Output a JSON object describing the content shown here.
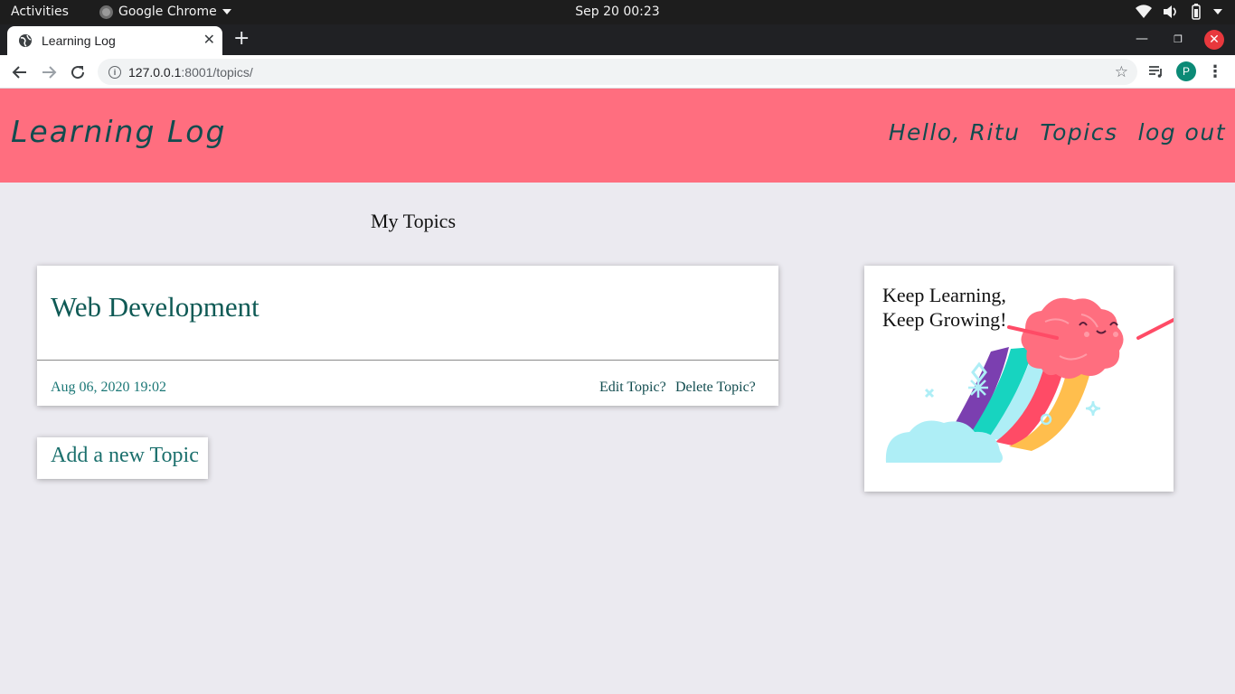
{
  "system_bar": {
    "activities": "Activities",
    "app_name": "Google Chrome",
    "clock": "Sep 20  00:23"
  },
  "browser": {
    "tab_title": "Learning Log",
    "url_host": "127.0.0.1",
    "url_rest": ":8001/topics/",
    "profile_initial": "P"
  },
  "site": {
    "brand": "Learning Log",
    "nav": {
      "greeting": "Hello, Ritu",
      "topics": "Topics",
      "logout": "log out"
    }
  },
  "main": {
    "title": "My Topics",
    "topics": [
      {
        "name": "Web Development",
        "date": "Aug 06, 2020 19:02",
        "edit_label": "Edit Topic?",
        "delete_label": "Delete Topic?"
      }
    ],
    "add_label": "Add a new Topic"
  },
  "promo": {
    "line1": "Keep Learning,",
    "line2": "Keep Growing!"
  },
  "colors": {
    "header_bg": "#ff6e7f",
    "page_bg": "#ebeaf0",
    "accent_text": "#114c4f",
    "link_teal": "#1b7776"
  }
}
